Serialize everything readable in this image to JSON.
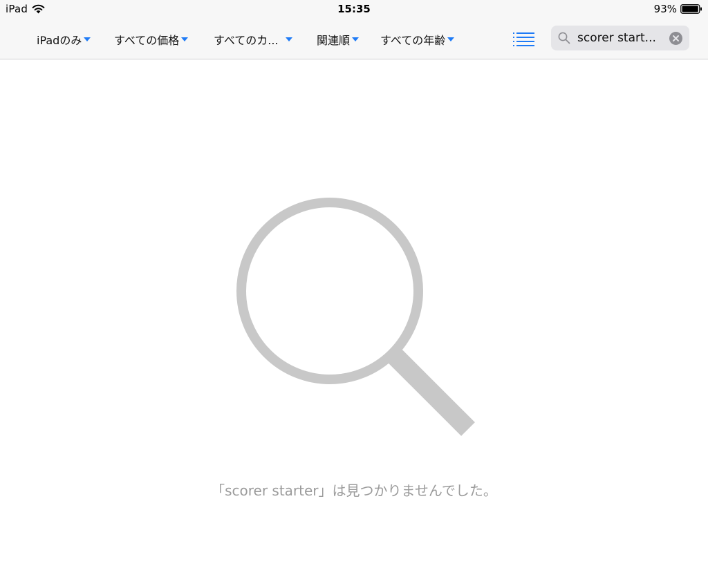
{
  "status_bar": {
    "device": "iPad",
    "time": "15:35",
    "battery_percent": "93%",
    "battery_level": 0.93
  },
  "filters": [
    {
      "label": "iPadのみ"
    },
    {
      "label": "すべての価格"
    },
    {
      "label": "すべてのカ..."
    },
    {
      "label": "関連順"
    },
    {
      "label": "すべての年齢"
    }
  ],
  "search": {
    "value": "scorer start..."
  },
  "empty_state": {
    "message": "「scorer starter」は見つかりませんでした。"
  },
  "colors": {
    "accent": "#1f7bf6",
    "empty_icon": "#c8c8c8",
    "empty_text": "#9b9b9b"
  },
  "icons": {
    "wifi": "wifi-icon",
    "battery": "battery-icon",
    "list": "list-icon",
    "search": "search-icon",
    "clear": "clear-icon",
    "empty": "magnifier-icon"
  }
}
